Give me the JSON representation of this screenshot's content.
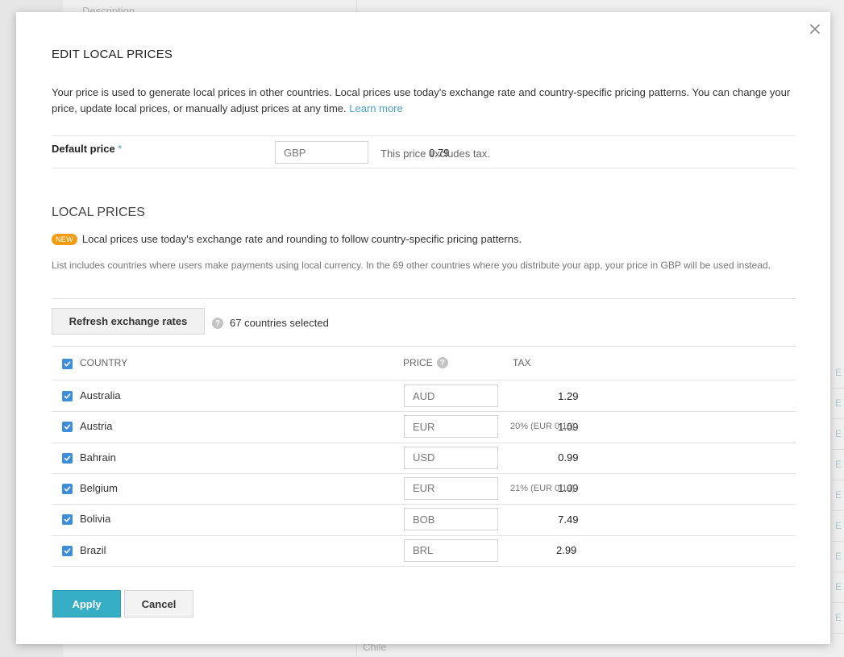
{
  "background": {
    "header_text": "Description",
    "chile": "Chile",
    "col_letter": "E"
  },
  "dialog": {
    "title": "EDIT LOCAL PRICES",
    "intro": "Your price is used to generate local prices in other countries. Local prices use today's exchange rate and country-specific pricing patterns. You can change your price, update local prices, or manually adjust prices at any time.",
    "learn_more": "Learn more",
    "default_price": {
      "label": "Default price",
      "required_mark": "*",
      "currency": "GBP",
      "value": "0.79",
      "note": "This price excludes tax."
    },
    "local_prices": {
      "title": "LOCAL PRICES",
      "badge": "NEW",
      "new_text": "Local prices use today's exchange rate and rounding to follow country-specific pricing patterns.",
      "list_note": "List includes countries where users make payments using local currency. In the 69 other countries where you distribute your app, your price in GBP will be used instead.",
      "refresh_label": "Refresh exchange rates",
      "help_glyph": "?",
      "selected_text": "67 countries selected",
      "columns": {
        "country": "COUNTRY",
        "price": "PRICE",
        "tax": "TAX"
      },
      "rows": [
        {
          "country": "Australia",
          "currency": "AUD",
          "price": "1.29",
          "tax": ""
        },
        {
          "country": "Austria",
          "currency": "EUR",
          "price": "1.09",
          "tax": "20% (EUR 0.18)"
        },
        {
          "country": "Bahrain",
          "currency": "USD",
          "price": "0.99",
          "tax": ""
        },
        {
          "country": "Belgium",
          "currency": "EUR",
          "price": "1.09",
          "tax": "21% (EUR 0.19)"
        },
        {
          "country": "Bolivia",
          "currency": "BOB",
          "price": "7.49",
          "tax": ""
        },
        {
          "country": "Brazil",
          "currency": "BRL",
          "price": "2.99",
          "tax": ""
        }
      ]
    },
    "buttons": {
      "apply": "Apply",
      "cancel": "Cancel"
    }
  },
  "colors": {
    "accent": "#36aec6",
    "checkbox": "#3d8ed8",
    "badge": "#f39c12",
    "link": "#4aa3c7"
  },
  "icons": {
    "close": "close-icon",
    "help": "help-icon",
    "checkbox": "checkmark-icon"
  }
}
